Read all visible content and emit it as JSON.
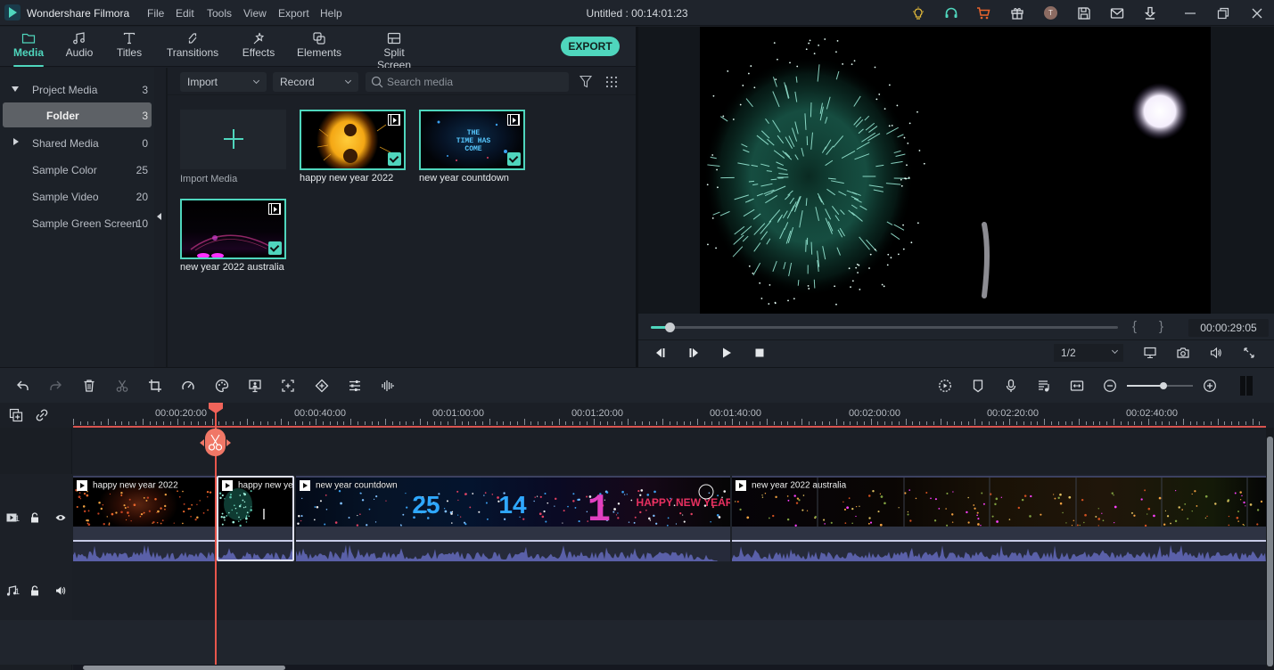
{
  "app": {
    "name": "Wondershare Filmora",
    "document_title": "Untitled : 00:14:01:23",
    "menu": [
      "File",
      "Edit",
      "Tools",
      "View",
      "Export",
      "Help"
    ],
    "title_icons": [
      "lightbulb-icon",
      "headset-icon",
      "cart-icon",
      "gift-icon",
      "avatar",
      "save-icon",
      "mail-icon",
      "download-icon"
    ],
    "avatar_initial": "T",
    "window_controls": [
      "minimize",
      "restore",
      "close"
    ]
  },
  "nav": {
    "tabs": [
      {
        "label": "Media",
        "icon": "folder-icon",
        "active": true
      },
      {
        "label": "Audio",
        "icon": "music-note-icon",
        "active": false
      },
      {
        "label": "Titles",
        "icon": "text-icon",
        "active": false
      },
      {
        "label": "Transitions",
        "icon": "transitions-icon",
        "active": false
      },
      {
        "label": "Effects",
        "icon": "magic-wand-icon",
        "active": false
      },
      {
        "label": "Elements",
        "icon": "elements-icon",
        "active": false
      },
      {
        "label": "Split Screen",
        "icon": "split-screen-icon",
        "active": false
      }
    ],
    "export_label": "EXPORT"
  },
  "sidebar": {
    "items": [
      {
        "label": "Project Media",
        "count": "3",
        "caret": "down"
      },
      {
        "label": "Folder",
        "count": "3",
        "selected": true
      },
      {
        "label": "Shared Media",
        "count": "0",
        "caret": "right"
      },
      {
        "label": "Sample Color",
        "count": "25"
      },
      {
        "label": "Sample Video",
        "count": "20"
      },
      {
        "label": "Sample Green Screen",
        "count": "10"
      }
    ]
  },
  "media": {
    "import_label": "Import",
    "record_label": "Record",
    "search_placeholder": "Search media",
    "import_media_label": "Import Media",
    "items": [
      {
        "name": "happy new year 2022",
        "type": "video",
        "selected": true
      },
      {
        "name": "new year countdown",
        "type": "video",
        "selected": true,
        "thumb_text": "THE TIME HAS COME"
      },
      {
        "name": "new year 2022 australia",
        "type": "video",
        "selected": true
      }
    ]
  },
  "preview": {
    "progress": 0.04,
    "timecode": "00:00:29:05",
    "mark_in": "{",
    "mark_out": "}",
    "quality": "1/2"
  },
  "timeline": {
    "ruler_labels": [
      "00:00:20:00",
      "00:00:40:00",
      "00:01:00:00",
      "00:01:20:00",
      "00:01:40:00",
      "00:02:00:00",
      "00:02:20:00",
      "00:02:40:00"
    ],
    "zoom_level": 0.55,
    "playhead_time": "00:00:29:05",
    "tracks": [
      {
        "id": "video-1",
        "number": "1"
      },
      {
        "id": "audio-1",
        "number": "1"
      }
    ],
    "clips": [
      {
        "label": "happy new year 2022"
      },
      {
        "label": "happy new year"
      },
      {
        "label": "new year countdown",
        "frame_texts": [
          "25",
          "14",
          "1",
          "HAPPY NEW YEAR"
        ]
      },
      {
        "label": "new year 2022 australia"
      }
    ]
  }
}
